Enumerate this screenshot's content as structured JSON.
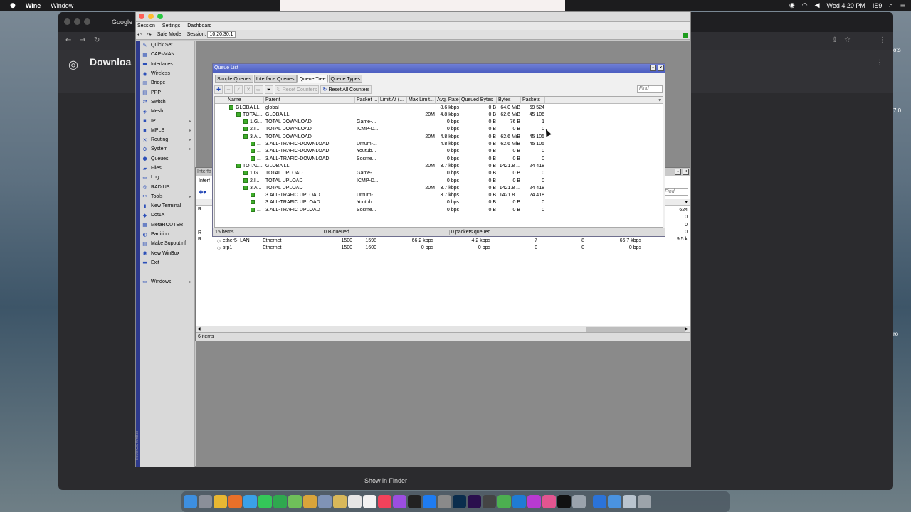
{
  "menubar": {
    "app": "Wine",
    "menu": [
      "Window"
    ],
    "clock": "Wed 4.20 PM",
    "indicator": "IS9"
  },
  "browser": {
    "tab_label": "Google",
    "page_heading": "Downloa",
    "show_in_finder": "Show in Finder"
  },
  "winbox": {
    "menu": [
      "Session",
      "Settings",
      "Dashboard"
    ],
    "safe_mode": "Safe Mode",
    "session_label": "Session:",
    "session_value": "10.20.30.1",
    "vertical_label": "RouterOS WinBox",
    "sidebar": [
      {
        "label": "Quick Set",
        "icon": "quick-set-icon",
        "glyph": "✎",
        "arrow": false
      },
      {
        "label": "CAPsMAN",
        "icon": "capsman-icon",
        "glyph": "▦",
        "arrow": false
      },
      {
        "label": "Interfaces",
        "icon": "interfaces-icon",
        "glyph": "▬",
        "arrow": false
      },
      {
        "label": "Wireless",
        "icon": "wireless-icon",
        "glyph": "◉",
        "arrow": false
      },
      {
        "label": "Bridge",
        "icon": "bridge-icon",
        "glyph": "▥",
        "arrow": false
      },
      {
        "label": "PPP",
        "icon": "ppp-icon",
        "glyph": "▤",
        "arrow": false
      },
      {
        "label": "Switch",
        "icon": "switch-icon",
        "glyph": "⇄",
        "arrow": false
      },
      {
        "label": "Mesh",
        "icon": "mesh-icon",
        "glyph": "◈",
        "arrow": false
      },
      {
        "label": "IP",
        "icon": "ip-icon",
        "glyph": "▪",
        "arrow": true
      },
      {
        "label": "MPLS",
        "icon": "mpls-icon",
        "glyph": "▪",
        "arrow": true
      },
      {
        "label": "Routing",
        "icon": "routing-icon",
        "glyph": "✕",
        "arrow": true
      },
      {
        "label": "System",
        "icon": "system-icon",
        "glyph": "⚙",
        "arrow": true
      },
      {
        "label": "Queues",
        "icon": "queues-icon",
        "glyph": "●",
        "arrow": false
      },
      {
        "label": "Files",
        "icon": "files-icon",
        "glyph": "▰",
        "arrow": false
      },
      {
        "label": "Log",
        "icon": "log-icon",
        "glyph": "▭",
        "arrow": false
      },
      {
        "label": "RADIUS",
        "icon": "radius-icon",
        "glyph": "◎",
        "arrow": false
      },
      {
        "label": "Tools",
        "icon": "tools-icon",
        "glyph": "✂",
        "arrow": true
      },
      {
        "label": "New Terminal",
        "icon": "terminal-icon",
        "glyph": "▮",
        "arrow": false
      },
      {
        "label": "Dot1X",
        "icon": "dot1x-icon",
        "glyph": "◆",
        "arrow": false
      },
      {
        "label": "MetaROUTER",
        "icon": "metarouter-icon",
        "glyph": "▦",
        "arrow": false
      },
      {
        "label": "Partition",
        "icon": "partition-icon",
        "glyph": "◐",
        "arrow": false
      },
      {
        "label": "Make Supout.rif",
        "icon": "supout-icon",
        "glyph": "▤",
        "arrow": false
      },
      {
        "label": "New WinBox",
        "icon": "winbox-icon",
        "glyph": "◉",
        "arrow": false
      },
      {
        "label": "Exit",
        "icon": "exit-icon",
        "glyph": "▬",
        "arrow": false
      },
      {
        "label": "",
        "icon": "",
        "glyph": "",
        "arrow": false
      },
      {
        "label": "Windows",
        "icon": "windows-icon",
        "glyph": "▭",
        "arrow": true
      }
    ]
  },
  "interface_list": {
    "title": "Interfa",
    "tab": "Interf",
    "find_placeholder": "Find",
    "partial_values": [
      "624",
      "0",
      "0",
      "0",
      "9.5 k"
    ],
    "row_flags": [
      "R",
      "R",
      "R"
    ],
    "rows": [
      {
        "name": "ether5- LAN",
        "type": "Ethernet",
        "mtu": "1500",
        "l2mtu": "1598",
        "tx": "66.2 kbps",
        "rx": "4.2 kbps",
        "a": "7",
        "b": "8",
        "c": "66.7 kbps"
      },
      {
        "name": "sfp1",
        "type": "Ethernet",
        "mtu": "1500",
        "l2mtu": "1600",
        "tx": "0 bps",
        "rx": "0 bps",
        "a": "0",
        "b": "0",
        "c": "0 bps"
      }
    ],
    "footer": "6 items"
  },
  "queue_list": {
    "title": "Queue List",
    "tabs": [
      "Simple Queues",
      "Interface Queues",
      "Queue Tree",
      "Queue Types"
    ],
    "active_tab": 2,
    "toolbar": {
      "reset_counters": "Reset Counters",
      "reset_all_counters": "Reset All Counters",
      "find_placeholder": "Find"
    },
    "columns": [
      "Name",
      "Parent",
      "Packet ...",
      "Limit At (...",
      "Max Limit...",
      "Avg. Rate",
      "Queued Bytes",
      "Bytes",
      "Packets"
    ],
    "rows": [
      {
        "indent": 1,
        "name": "GLOBA LL",
        "parent": "global",
        "packet": "",
        "limit_at": "",
        "max_limit": "",
        "avg_rate": "8.6 kbps",
        "queued": "0 B",
        "bytes": "64.0 MiB",
        "packets": "69 524"
      },
      {
        "indent": 2,
        "name": "TOTAL...",
        "parent": "GLOBA LL",
        "packet": "",
        "limit_at": "",
        "max_limit": "20M",
        "avg_rate": "4.8 kbps",
        "queued": "0 B",
        "bytes": "62.6 MiB",
        "packets": "45 106"
      },
      {
        "indent": 3,
        "name": "1.G...",
        "parent": "TOTAL DOWNLOAD",
        "packet": "Game-...",
        "limit_at": "",
        "max_limit": "",
        "avg_rate": "0 bps",
        "queued": "0 B",
        "bytes": "76 B",
        "packets": "1"
      },
      {
        "indent": 3,
        "name": "2.I...",
        "parent": "TOTAL DOWNLOAD",
        "packet": "ICMP-D...",
        "limit_at": "",
        "max_limit": "",
        "avg_rate": "0 bps",
        "queued": "0 B",
        "bytes": "0 B",
        "packets": "0"
      },
      {
        "indent": 3,
        "name": "3.A...",
        "parent": "TOTAL DOWNLOAD",
        "packet": "",
        "limit_at": "",
        "max_limit": "20M",
        "avg_rate": "4.8 kbps",
        "queued": "0 B",
        "bytes": "62.6 MiB",
        "packets": "45 105"
      },
      {
        "indent": 4,
        "name": "...",
        "parent": "3.ALL-TRAFIC-DOWNLOAD",
        "packet": "Umum-...",
        "limit_at": "",
        "max_limit": "",
        "avg_rate": "4.8 kbps",
        "queued": "0 B",
        "bytes": "62.6 MiB",
        "packets": "45 105"
      },
      {
        "indent": 4,
        "name": "...",
        "parent": "3.ALL-TRAFIC-DOWNLOAD",
        "packet": "Youtub...",
        "limit_at": "",
        "max_limit": "",
        "avg_rate": "0 bps",
        "queued": "0 B",
        "bytes": "0 B",
        "packets": "0"
      },
      {
        "indent": 4,
        "name": "...",
        "parent": "3.ALL-TRAFIC-DOWNLOAD",
        "packet": "Sosme...",
        "limit_at": "",
        "max_limit": "",
        "avg_rate": "0 bps",
        "queued": "0 B",
        "bytes": "0 B",
        "packets": "0"
      },
      {
        "indent": 2,
        "name": "TOTAL...",
        "parent": "GLOBA LL",
        "packet": "",
        "limit_at": "",
        "max_limit": "20M",
        "avg_rate": "3.7 kbps",
        "queued": "0 B",
        "bytes": "1421.8 ...",
        "packets": "24 418"
      },
      {
        "indent": 3,
        "name": "1.G...",
        "parent": "TOTAL UPLOAD",
        "packet": "Game-...",
        "limit_at": "",
        "max_limit": "",
        "avg_rate": "0 bps",
        "queued": "0 B",
        "bytes": "0 B",
        "packets": "0"
      },
      {
        "indent": 3,
        "name": "2.I...",
        "parent": "TOTAL UPLOAD",
        "packet": "ICMP-D...",
        "limit_at": "",
        "max_limit": "",
        "avg_rate": "0 bps",
        "queued": "0 B",
        "bytes": "0 B",
        "packets": "0"
      },
      {
        "indent": 3,
        "name": "3.A...",
        "parent": "TOTAL UPLOAD",
        "packet": "",
        "limit_at": "",
        "max_limit": "20M",
        "avg_rate": "3.7 kbps",
        "queued": "0 B",
        "bytes": "1421.8 ...",
        "packets": "24 418"
      },
      {
        "indent": 4,
        "name": "...",
        "parent": "3.ALL-TRAFIC UPLOAD",
        "packet": "Umum-...",
        "limit_at": "",
        "max_limit": "",
        "avg_rate": "3.7 kbps",
        "queued": "0 B",
        "bytes": "1421.8 ...",
        "packets": "24 418"
      },
      {
        "indent": 4,
        "name": "...",
        "parent": "3.ALL-TRAFIC UPLOAD",
        "packet": "Youtub...",
        "limit_at": "",
        "max_limit": "",
        "avg_rate": "0 bps",
        "queued": "0 B",
        "bytes": "0 B",
        "packets": "0"
      },
      {
        "indent": 4,
        "name": "...",
        "parent": "3.ALL-TRAFIC UPLOAD",
        "packet": "Sosme...",
        "limit_at": "",
        "max_limit": "",
        "avg_rate": "0 bps",
        "queued": "0 B",
        "bytes": "0 B",
        "packets": "0"
      }
    ],
    "footer": {
      "items": "15 items",
      "queued": "0 B queued",
      "packets_queued": "0 packets queued"
    }
  },
  "right_peek": [
    "ots",
    "7.0",
    "ro"
  ],
  "dock": [
    {
      "icon": "finder-icon",
      "color": "#3d8fe0"
    },
    {
      "icon": "launchpad-icon",
      "color": "#8a8f99"
    },
    {
      "icon": "chrome-icon",
      "color": "#e8b732"
    },
    {
      "icon": "firefox-icon",
      "color": "#e8702a"
    },
    {
      "icon": "safari-icon",
      "color": "#3aa0e8"
    },
    {
      "icon": "messages-icon",
      "color": "#34c759"
    },
    {
      "icon": "facetime-icon",
      "color": "#2fa84f"
    },
    {
      "icon": "maps-icon",
      "color": "#6fbf5a"
    },
    {
      "icon": "photos-icon",
      "color": "#d9a43a"
    },
    {
      "icon": "preview-icon",
      "color": "#7f93b5"
    },
    {
      "icon": "notes-icon",
      "color": "#d8b85a"
    },
    {
      "icon": "calendar-icon",
      "color": "#e5e5e5"
    },
    {
      "icon": "reminders-icon",
      "color": "#f2f2f2"
    },
    {
      "icon": "music-icon",
      "color": "#f2425b"
    },
    {
      "icon": "podcasts-icon",
      "color": "#9b4ee0"
    },
    {
      "icon": "tv-icon",
      "color": "#222"
    },
    {
      "icon": "appstore-icon",
      "color": "#1e7cf2"
    },
    {
      "icon": "settings-icon",
      "color": "#8a8a8a"
    },
    {
      "icon": "photoshop-icon",
      "color": "#0a2d4d"
    },
    {
      "icon": "premiere-icon",
      "color": "#2a0f4d"
    },
    {
      "icon": "app-icon",
      "color": "#444"
    },
    {
      "icon": "box-icon",
      "color": "#4caf50"
    },
    {
      "icon": "vscode-icon",
      "color": "#1f7bd4"
    },
    {
      "icon": "flower-icon",
      "color": "#b83ad1"
    },
    {
      "icon": "pink-app-icon",
      "color": "#e25590"
    },
    {
      "icon": "terminal-icon",
      "color": "#111"
    },
    {
      "icon": "drive-icon",
      "color": "#9aa3ad"
    },
    {
      "icon": "network-icon",
      "color": "#2b73d9"
    },
    {
      "icon": "folder-icon",
      "color": "#4a93e0"
    },
    {
      "icon": "downloads-icon",
      "color": "#b9c4cf"
    },
    {
      "icon": "trash-icon",
      "color": "#9ca3aa"
    }
  ]
}
